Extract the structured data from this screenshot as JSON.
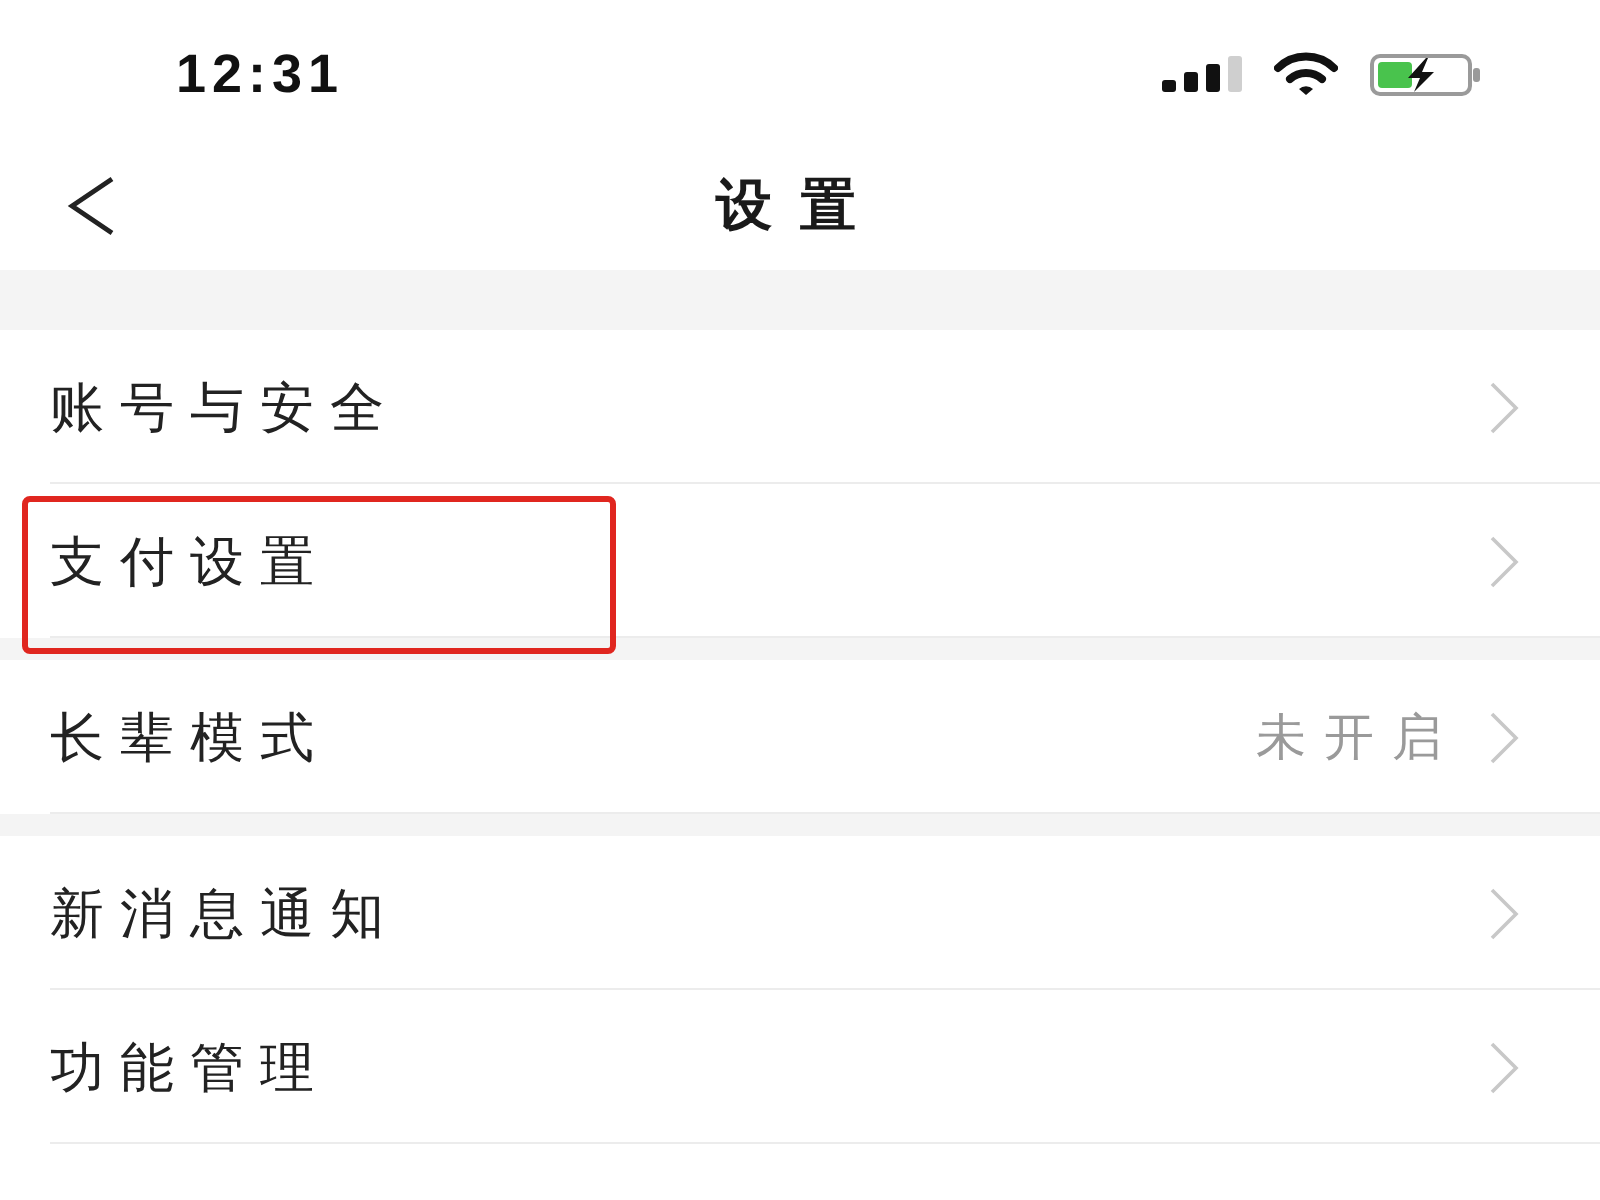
{
  "status_bar": {
    "time": "12:31"
  },
  "nav_bar": {
    "title": "设置"
  },
  "groups": [
    {
      "items": [
        {
          "label": "账号与安全",
          "highlighted": false
        },
        {
          "label": "支付设置",
          "highlighted": true
        }
      ]
    },
    {
      "items": [
        {
          "label": "长辈模式",
          "value": "未开启",
          "highlighted": false
        }
      ]
    },
    {
      "items": [
        {
          "label": "新消息通知",
          "highlighted": false
        },
        {
          "label": "功能管理",
          "highlighted": false
        }
      ]
    }
  ]
}
